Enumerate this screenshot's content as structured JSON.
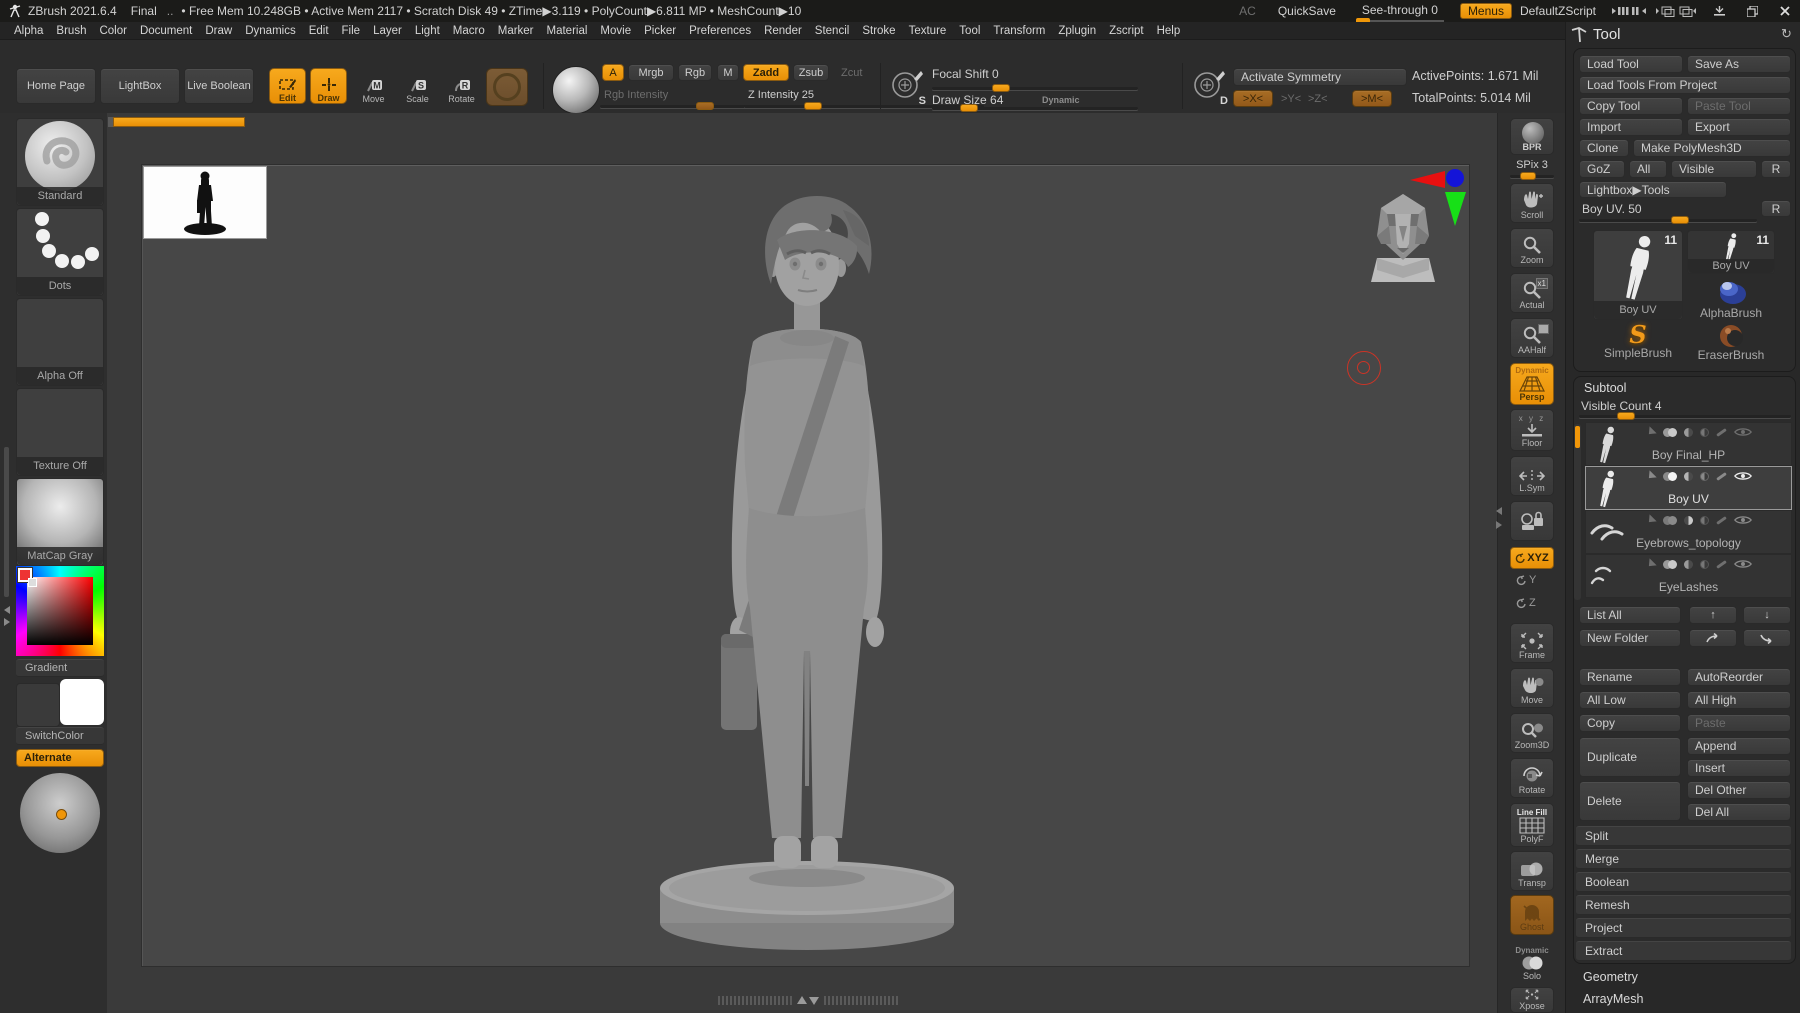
{
  "titlebar": {
    "title": "ZBrush 2021.6.4",
    "doc": "Final",
    "sep": "..",
    "stats": "• Free Mem 10.248GB • Active Mem 2117 • Scratch Disk 49 •  ZTime▶3.119 • PolyCount▶6.811 MP  • MeshCount▶10",
    "ac": "AC",
    "quicksave": "QuickSave",
    "seethrough": "See-through 0",
    "menus": "Menus",
    "zscript": "DefaultZScript"
  },
  "menubar": {
    "items": [
      "Alpha",
      "Brush",
      "Color",
      "Document",
      "Draw",
      "Dynamics",
      "Edit",
      "File",
      "Layer",
      "Light",
      "Macro",
      "Marker",
      "Material",
      "Movie",
      "Picker",
      "Preferences",
      "Render",
      "Stencil",
      "Stroke",
      "Texture",
      "Tool",
      "Transform",
      "Zplugin",
      "Zscript",
      "Help"
    ]
  },
  "toolbar": {
    "home_page": "Home Page",
    "lightbox": "LightBox",
    "live_boolean": "Live Boolean",
    "edit": "Edit",
    "draw": "Draw",
    "move": "Move",
    "scale": "Scale",
    "rotate": "Rotate",
    "icon_letters": {
      "move": "M",
      "scale": "S",
      "rotate": "R",
      "stroke": "S",
      "symmetry": "D"
    },
    "a": "A",
    "mrgb": "Mrgb",
    "rgb": "Rgb",
    "m": "M",
    "zadd": "Zadd",
    "zsub": "Zsub",
    "zcut": "Zcut",
    "rgb_intensity": "Rgb Intensity",
    "z_intensity": "Z Intensity 25",
    "focal_shift": "Focal Shift 0",
    "draw_size": "Draw Size 64",
    "dynamic": "Dynamic",
    "activate_symmetry": "Activate Symmetry",
    "sym_x": ">X<",
    "sym_y": ">Y<",
    "sym_z": ">Z<",
    "sym_m": ">M<",
    "active_points": "ActivePoints: 1.671 Mil",
    "total_points": "TotalPoints: 5.014 Mil"
  },
  "left_shelf": {
    "labels": [
      "Standard",
      "Dots",
      "Alpha Off",
      "Texture Off",
      "MatCap Gray",
      "Gradient",
      "SwitchColor"
    ],
    "alternate": "Alternate"
  },
  "right_shelf": {
    "items": [
      {
        "label": "BPR"
      },
      {
        "label": "SPix 3"
      },
      {
        "label": "Scroll"
      },
      {
        "label": "Zoom"
      },
      {
        "label": "Actual"
      },
      {
        "label": "AAHalf"
      },
      {
        "top": "Dynamic",
        "label": "Persp"
      },
      {
        "top": "x y z",
        "label": "Floor"
      },
      {
        "label": "L.Sym"
      },
      {
        "label": "XYZ"
      },
      {
        "label": "Y"
      },
      {
        "label": "Z"
      },
      {
        "label": "Frame"
      },
      {
        "label": "Move"
      },
      {
        "label": "Zoom3D"
      },
      {
        "label": "Rotate"
      },
      {
        "top": "Line Fill",
        "label": "PolyF"
      },
      {
        "label": "Transp"
      },
      {
        "label": "Ghost"
      },
      {
        "top": "Dynamic",
        "label": "Solo"
      },
      {
        "label": "Xpose"
      }
    ]
  },
  "tool_panel": {
    "header": "Tool",
    "load_tool": "Load Tool",
    "save_as": "Save As",
    "load_tools_from_project": "Load Tools From Project",
    "copy_tool": "Copy Tool",
    "paste_tool": "Paste Tool",
    "import": "Import",
    "export": "Export",
    "clone": "Clone",
    "make_polymesh3d": "Make PolyMesh3D",
    "goz": "GoZ",
    "all": "All",
    "visible": "Visible",
    "r": "R",
    "lightbox_tools": "Lightbox▶Tools",
    "tool_slider": "Boy UV. 50",
    "r2": "R",
    "thumbs": {
      "big": {
        "label": "Boy UV",
        "badge": "11"
      },
      "small": {
        "label": "Boy UV",
        "badge": "11"
      },
      "alpha": {
        "label": "AlphaBrush"
      },
      "simple": {
        "label": "SimpleBrush"
      },
      "eraser": {
        "label": "EraserBrush"
      }
    }
  },
  "subtool": {
    "header": "Subtool",
    "visible_count": "Visible Count 4",
    "rows": [
      {
        "label": "Boy Final_HP",
        "selected": false
      },
      {
        "label": "Boy UV",
        "selected": true
      },
      {
        "label": "Eyebrows_topology",
        "selected": false
      },
      {
        "label": "EyeLashes",
        "selected": false
      }
    ],
    "list_all": "List All",
    "new_folder": "New Folder",
    "up": "↑",
    "down": "↓",
    "rename": "Rename",
    "autoreorder": "AutoReorder",
    "all_low": "All Low",
    "all_high": "All High",
    "copy": "Copy",
    "paste": "Paste",
    "duplicate": "Duplicate",
    "append": "Append",
    "insert": "Insert",
    "delete": "Delete",
    "del_other": "Del Other",
    "del_all": "Del All",
    "sections": [
      "Split",
      "Merge",
      "Boolean",
      "Remesh",
      "Project",
      "Extract"
    ]
  },
  "bottom_sections": [
    "Geometry",
    "ArrayMesh"
  ],
  "colors": {
    "accent": "#f09609",
    "half_active": "#a4671f",
    "canvas": "#474747"
  }
}
